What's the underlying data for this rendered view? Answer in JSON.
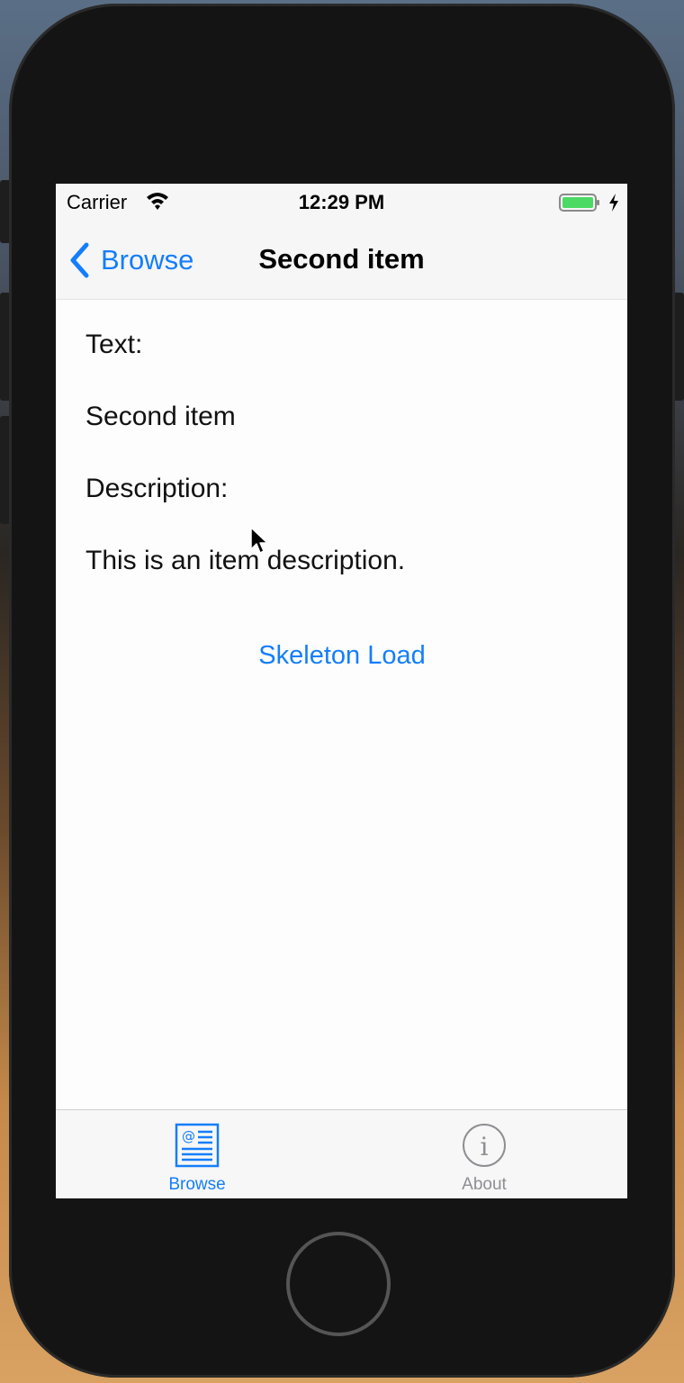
{
  "status_bar": {
    "carrier": "Carrier",
    "time": "12:29 PM",
    "icons": [
      "wifi-icon",
      "battery-icon",
      "charging-bolt-icon"
    ],
    "battery_color": "#4cd964"
  },
  "nav_bar": {
    "back_label": "Browse",
    "title": "Second item"
  },
  "content": {
    "text_label": "Text:",
    "text_value": "Second item",
    "description_label": "Description:",
    "description_value": "This is an item description.",
    "skeleton_button_label": "Skeleton Load"
  },
  "tab_bar": {
    "tabs": [
      {
        "label": "Browse",
        "icon": "browse-list-icon",
        "selected": true
      },
      {
        "label": "About",
        "icon": "info-icon",
        "selected": false
      }
    ]
  },
  "colors": {
    "accent": "#147efb",
    "inactive_tab": "#8e8e93"
  }
}
